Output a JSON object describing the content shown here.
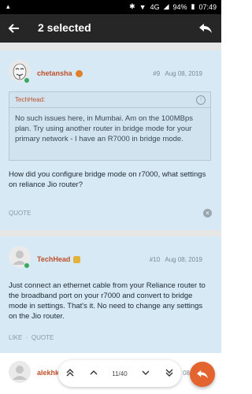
{
  "status_bar": {
    "signal": "4G",
    "battery": "94%",
    "time": "07:49"
  },
  "app_bar": {
    "title": "2 selected"
  },
  "posts": [
    {
      "username": "chetansha",
      "number": "#9",
      "date": "Aug 08, 2019",
      "quote": {
        "author": "TechHead:",
        "text": "No such issues here, in Mumbai. Am on the 100MBps plan. Try using another router in bridge mode for your primary network - I have an R7000 in bridge mode."
      },
      "text": "How did you configure bridge mode on r7000, what settings on reliance Jio router?",
      "actions": [
        "QUOTE"
      ]
    },
    {
      "username": "TechHead",
      "number": "#10",
      "date": "Aug 08, 2019",
      "text": "Just connect an ethernet cable from your Reliance router to the broadband port on your r7000 and convert to bridge mode in settings. That's it. No need to change any settings on the Jio router.",
      "actions": [
        "LIKE",
        "QUOTE"
      ]
    },
    {
      "username": "alekhkh",
      "date": "Aug 08"
    }
  ],
  "pager": {
    "label": "11/40"
  },
  "colors": {
    "accent": "#e3642e",
    "post_bg": "#d6e9f5",
    "username": "#c0502a"
  }
}
